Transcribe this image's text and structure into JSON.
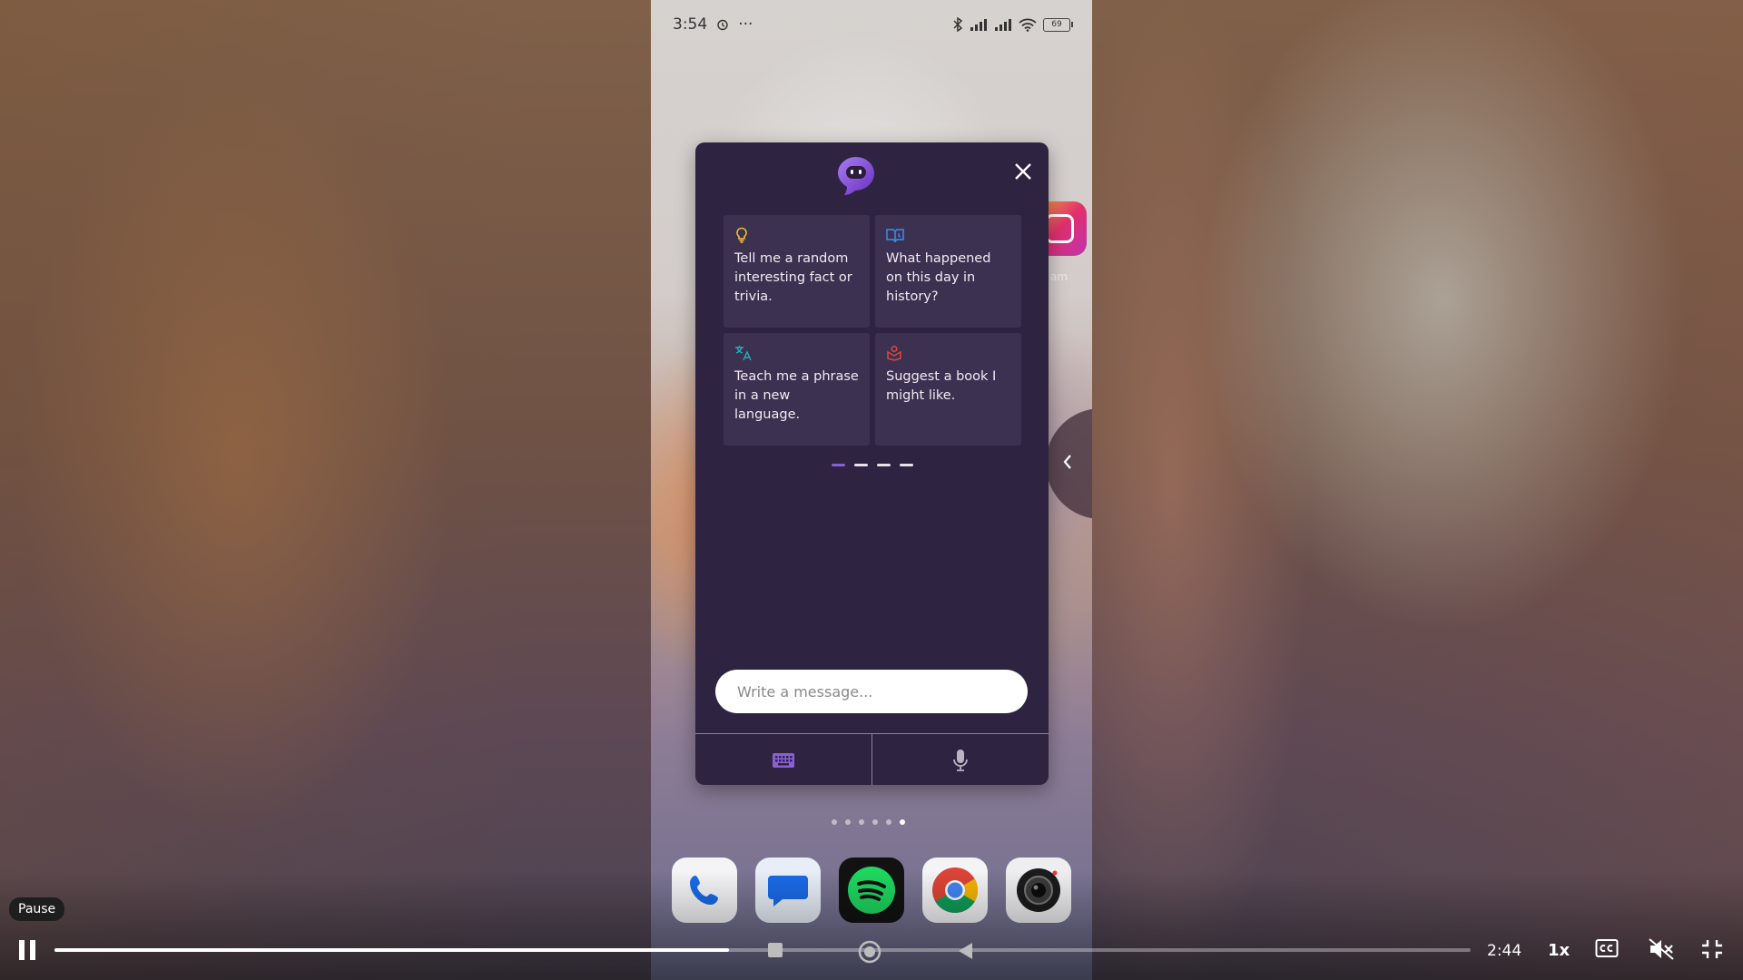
{
  "status_bar": {
    "time": "3:54",
    "more": "···",
    "battery": "69"
  },
  "home_app": {
    "label": "am"
  },
  "widget": {
    "cards": [
      {
        "icon": "lightbulb-icon",
        "text": "Tell me a random interesting fact or trivia."
      },
      {
        "icon": "history-book-icon",
        "text": "What happened on this day in history?"
      },
      {
        "icon": "translate-icon",
        "text": "Teach me a phrase in a new language."
      },
      {
        "icon": "book-suggest-icon",
        "text": "Suggest a book I might like."
      }
    ],
    "pager": {
      "count": 4,
      "active": 0
    },
    "input_placeholder": "Write a message...",
    "modes": [
      "keyboard-icon",
      "microphone-icon"
    ]
  },
  "home_page_dots": {
    "count": 6,
    "active": 5
  },
  "dock": [
    "phone-app-icon",
    "messages-app-icon",
    "spotify-app-icon",
    "chrome-app-icon",
    "camera-app-icon"
  ],
  "player": {
    "tooltip": "Pause",
    "time": "2:44",
    "speed": "1x",
    "progress": 0.476
  },
  "colors": {
    "widget_bg": "#2e2340",
    "card_bg": "#3c3150",
    "accent": "#8a5fd6",
    "bulb": "#f2c12e",
    "history": "#3d8df0",
    "translate": "#2aa9b8",
    "book": "#e0443c"
  }
}
